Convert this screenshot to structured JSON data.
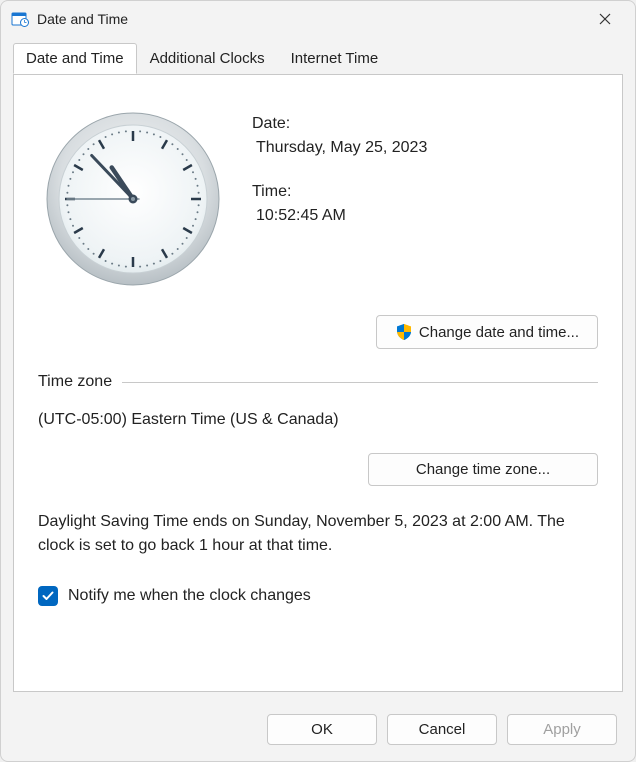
{
  "window": {
    "title": "Date and Time"
  },
  "tabs": [
    {
      "label": "Date and Time"
    },
    {
      "label": "Additional Clocks"
    },
    {
      "label": "Internet Time"
    }
  ],
  "main": {
    "date_label": "Date:",
    "date_value": "Thursday, May 25, 2023",
    "time_label": "Time:",
    "time_value": "10:52:45 AM",
    "change_datetime_label": "Change date and time...",
    "timezone_section_label": "Time zone",
    "timezone_value": "(UTC-05:00) Eastern Time (US & Canada)",
    "change_timezone_label": "Change time zone...",
    "dst_text": "Daylight Saving Time ends on Sunday, November 5, 2023 at 2:00 AM. The clock is set to go back 1 hour at that time.",
    "notify_checkbox_label": "Notify me when the clock changes",
    "notify_checked": true
  },
  "footer": {
    "ok": "OK",
    "cancel": "Cancel",
    "apply": "Apply"
  },
  "clock": {
    "hour": 10,
    "minute": 52,
    "second": 45
  }
}
